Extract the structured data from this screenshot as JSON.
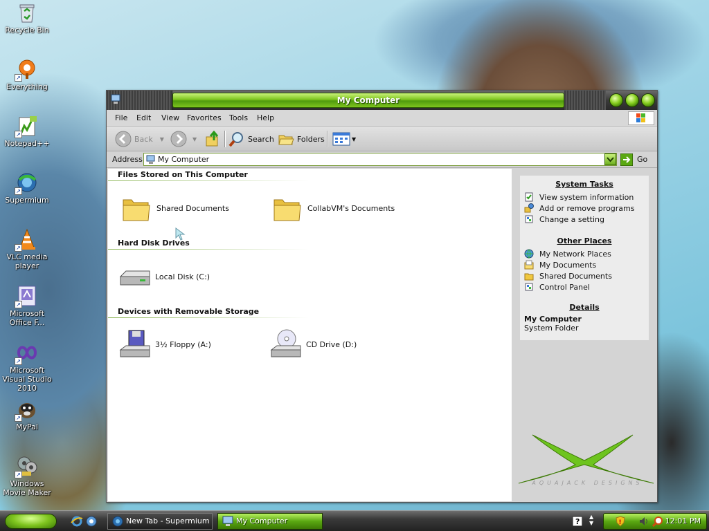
{
  "desktop": {
    "icons": [
      {
        "label": "Recycle Bin"
      },
      {
        "label": "Everything"
      },
      {
        "label": "Notepad++"
      },
      {
        "label": "Supermium"
      },
      {
        "label": "VLC media player"
      },
      {
        "label": "Microsoft Office F..."
      },
      {
        "label": "Microsoft Visual Studio 2010"
      },
      {
        "label": "MyPal"
      },
      {
        "label": "Windows Movie Maker"
      }
    ]
  },
  "window": {
    "title": "My Computer",
    "menu": [
      "File",
      "Edit",
      "View",
      "Favorites",
      "Tools",
      "Help"
    ],
    "toolbar": {
      "back": "Back",
      "search": "Search",
      "folders": "Folders"
    },
    "address": {
      "label": "Address",
      "value": "My Computer",
      "go": "Go"
    },
    "groups": [
      {
        "header": "Files Stored on This Computer",
        "items": [
          "Shared Documents",
          "CollabVM's Documents"
        ]
      },
      {
        "header": "Hard Disk Drives",
        "items": [
          "Local Disk (C:)"
        ]
      },
      {
        "header": "Devices with Removable Storage",
        "items": [
          "3½ Floppy (A:)",
          "CD Drive (D:)"
        ]
      }
    ],
    "taskpane": {
      "system_tasks": {
        "title": "System Tasks",
        "links": [
          "View system information",
          "Add or remove programs",
          "Change a setting"
        ]
      },
      "other_places": {
        "title": "Other Places",
        "links": [
          "My Network Places",
          "My Documents",
          "Shared Documents",
          "Control Panel"
        ]
      },
      "details": {
        "title": "Details",
        "name": "My Computer",
        "type": "System Folder"
      },
      "brand_text": "AQUAJACK DESIGNS"
    }
  },
  "taskbar": {
    "tasks": [
      "New Tab - Supermium",
      "My Computer"
    ],
    "clock": "12:01 PM"
  },
  "colors": {
    "accent_green": "#7ec41e",
    "dark_chrome": "#3a3a3a"
  }
}
